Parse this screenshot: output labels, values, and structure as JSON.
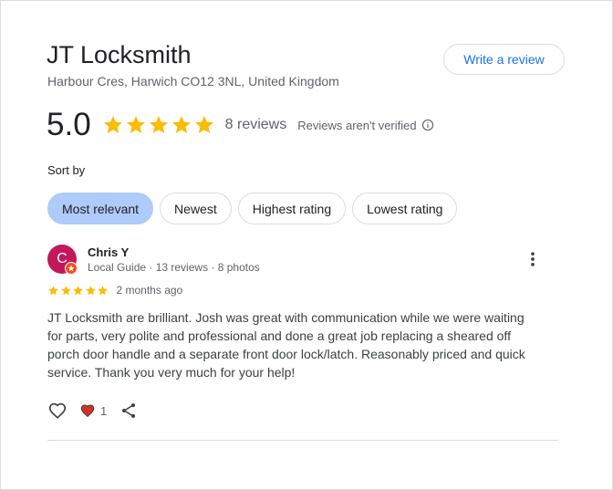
{
  "business": {
    "name": "JT Locksmith",
    "address": "Harbour Cres, Harwich CO12 3NL, United Kingdom"
  },
  "write_review_label": "Write a review",
  "rating": {
    "value": "5.0",
    "stars": 5,
    "reviews_count_text": "8 reviews",
    "verification_note": "Reviews aren't verified"
  },
  "sort": {
    "label": "Sort by",
    "options": [
      "Most relevant",
      "Newest",
      "Highest rating",
      "Lowest rating"
    ],
    "selected": "Most relevant"
  },
  "review": {
    "avatar_letter": "C",
    "reviewer_name": "Chris Y",
    "reviewer_meta": "Local Guide · 13 reviews · 8 photos",
    "stars": 5,
    "date": "2 months ago",
    "text": "JT Locksmith are brilliant. Josh was great with communication while we were waiting for parts, very polite and professional and done a great job replacing a sheared off porch door handle and a separate front door lock/latch. Reasonably priced and quick service. Thank you very much for your help!",
    "reaction_count": "1"
  },
  "colors": {
    "star": "#fbbc04",
    "accent": "#1a73e8",
    "chip_active": "#aecbfa",
    "avatar": "#c2185b",
    "heart_reaction": "#d93025"
  },
  "icons": {
    "star": "star-icon",
    "info": "info-icon",
    "more": "more-vert-icon",
    "like": "heart-outline-icon",
    "reaction": "heart-filled-icon",
    "share": "share-icon",
    "local_guide": "local-guide-badge-icon"
  }
}
